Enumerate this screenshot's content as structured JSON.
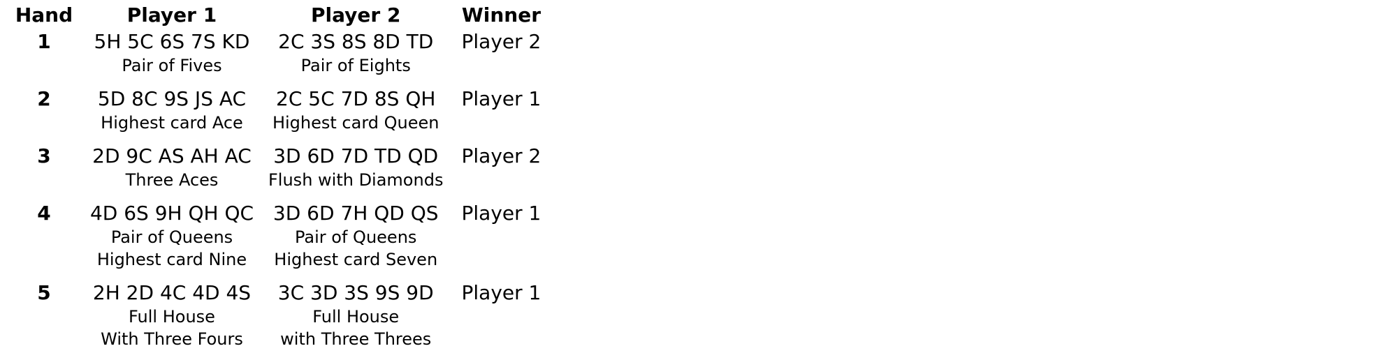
{
  "table": {
    "headers": {
      "hand": "Hand",
      "player1": "Player 1",
      "player2": "Player 2",
      "winner": "Winner"
    },
    "rows": [
      {
        "hand": "1",
        "player1": {
          "cards": "5H 5C 6S 7S KD",
          "desc": [
            "Pair of Fives"
          ]
        },
        "player2": {
          "cards": "2C 3S 8S 8D TD",
          "desc": [
            "Pair of Eights"
          ]
        },
        "winner": "Player 2"
      },
      {
        "hand": "2",
        "player1": {
          "cards": "5D 8C 9S JS AC",
          "desc": [
            "Highest card Ace"
          ]
        },
        "player2": {
          "cards": "2C 5C 7D 8S QH",
          "desc": [
            "Highest card Queen"
          ]
        },
        "winner": "Player 1"
      },
      {
        "hand": "3",
        "player1": {
          "cards": "2D 9C AS AH AC",
          "desc": [
            "Three Aces"
          ]
        },
        "player2": {
          "cards": "3D 6D 7D TD QD",
          "desc": [
            "Flush with Diamonds"
          ]
        },
        "winner": "Player 2"
      },
      {
        "hand": "4",
        "player1": {
          "cards": "4D 6S 9H QH QC",
          "desc": [
            "Pair of Queens",
            "Highest card Nine"
          ]
        },
        "player2": {
          "cards": "3D 6D 7H QD QS",
          "desc": [
            "Pair of Queens",
            "Highest card Seven"
          ]
        },
        "winner": "Player 1"
      },
      {
        "hand": "5",
        "player1": {
          "cards": "2H 2D 4C 4D 4S",
          "desc": [
            "Full House",
            "With Three Fours"
          ]
        },
        "player2": {
          "cards": "3C 3D 3S 9S 9D",
          "desc": [
            "Full House",
            "with Three Threes"
          ]
        },
        "winner": "Player 1"
      }
    ]
  }
}
